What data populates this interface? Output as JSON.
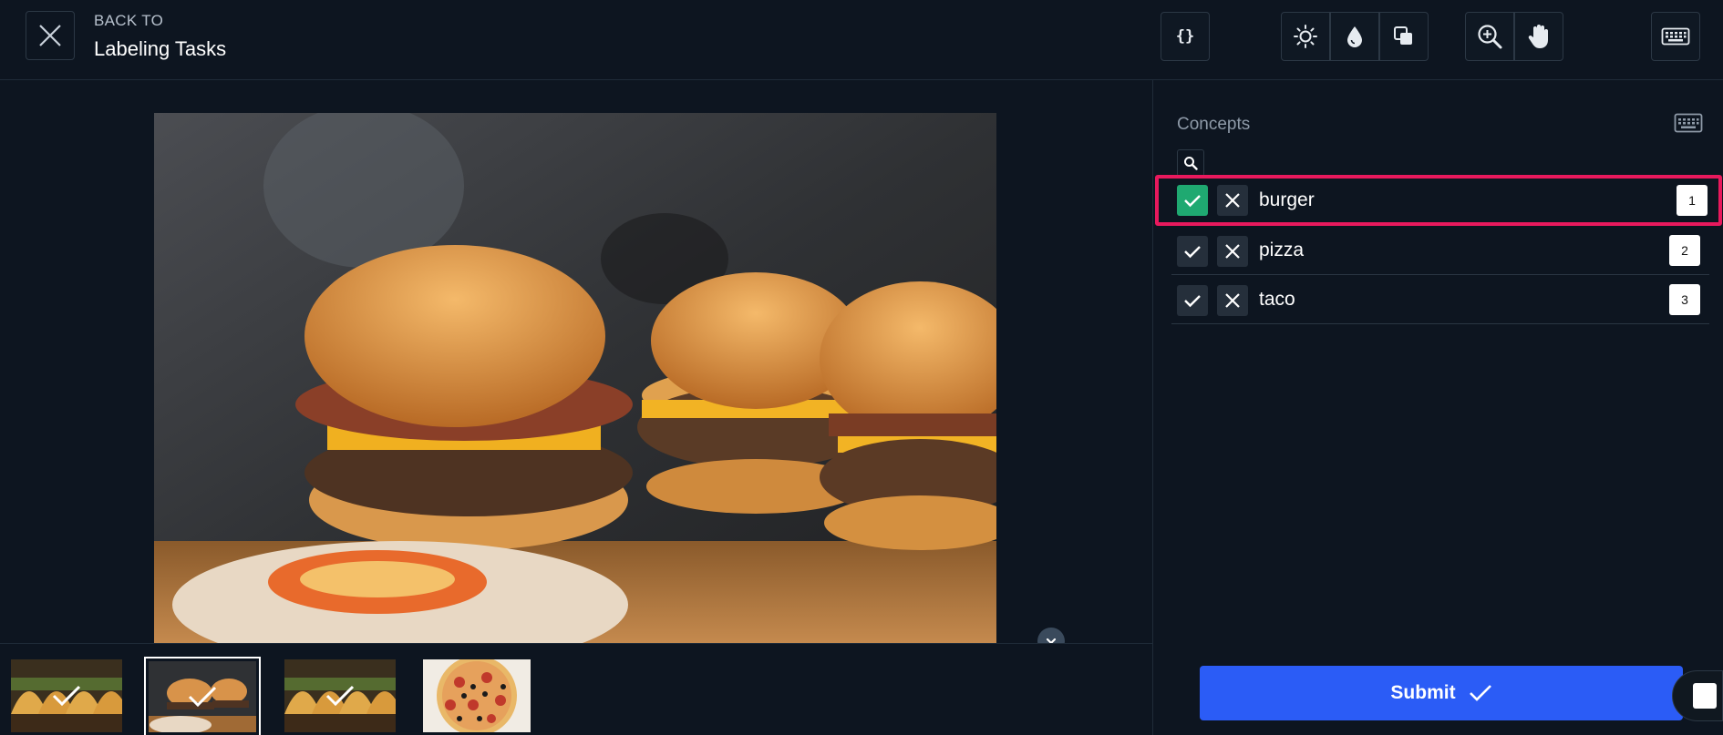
{
  "header": {
    "back_to": "BACK TO",
    "back_title": "Labeling Tasks"
  },
  "toolbar": {
    "buttons": [
      {
        "icon": "json-braces-icon"
      },
      {
        "icon": "brightness-icon"
      },
      {
        "icon": "saturation-drop-icon"
      },
      {
        "icon": "contrast-icon"
      },
      {
        "icon": "zoom-in-icon"
      },
      {
        "icon": "pan-hand-icon"
      },
      {
        "icon": "keyboard-icon"
      }
    ]
  },
  "concepts": {
    "title": "Concepts",
    "items": [
      {
        "label": "burger",
        "key": "1",
        "selected": true
      },
      {
        "label": "pizza",
        "key": "2",
        "selected": false
      },
      {
        "label": "taco",
        "key": "3",
        "selected": false
      }
    ]
  },
  "filmstrip": {
    "thumbs": [
      {
        "subject": "tacos",
        "labeled": true,
        "selected": false
      },
      {
        "subject": "burgers",
        "labeled": true,
        "selected": true
      },
      {
        "subject": "tacos",
        "labeled": true,
        "selected": false
      },
      {
        "subject": "pizza",
        "labeled": false,
        "selected": false
      }
    ]
  },
  "submit": {
    "label": "Submit"
  },
  "colors": {
    "background": "#0d1520",
    "accent_blue": "#2b5cf6",
    "check_green": "#1fa971",
    "highlight_pink": "#e8195d"
  }
}
